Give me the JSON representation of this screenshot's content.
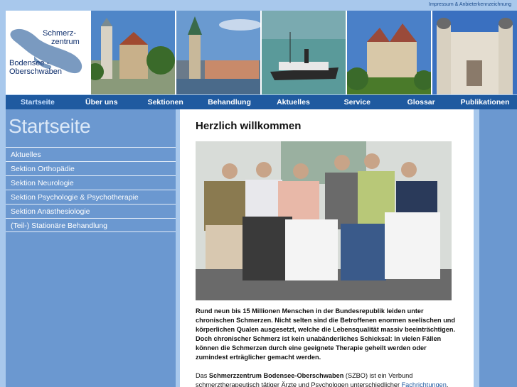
{
  "top": {
    "impressum": "Impressum & Anbieterkennzeichnung"
  },
  "logo": {
    "line1": "Schmerz-",
    "line2": "zentrum",
    "line3": "Bodensee -",
    "line4": "Oberschwaben"
  },
  "nav": {
    "items": [
      "Startseite",
      "Über uns",
      "Sektionen",
      "Behandlung",
      "Aktuelles",
      "Service",
      "Glossar",
      "Publikationen"
    ],
    "active_index": 0
  },
  "sidebar": {
    "title": "Startseite",
    "items": [
      "Aktuelles",
      "Sektion Orthopädie",
      "Sektion Neurologie",
      "Sektion Psychologie & Psychotherapie",
      "Sektion Anästhesiologie",
      "(Teil-) Stationäre Behandlung"
    ]
  },
  "main": {
    "heading": "Herzlich willkommen",
    "intro": "Rund neun bis 15 Millionen Menschen in der Bundesrepublik leiden unter chronischen Schmerzen. Nicht selten sind die Betroffenen enormen seelischen und körperlichen Qualen ausgesetzt, welche die Lebensqualität massiv beeinträchtigen. Doch chronischer Schmerz ist kein unabänderliches Schicksal: In vielen Fällen können die Schmerzen durch eine geeignete Therapie geheilt werden oder zumindest erträglicher gemacht werden.",
    "para2_start": "Das ",
    "para2_bold": "Schmerzzentrum Bodensee-Oberschwaben",
    "para2_mid": " (SZBO) ist ein Verbund schmerztherapeutisch tätiger Ärzte und Psychologen unterschiedlicher ",
    "para2_link": "Fachrichtungen",
    "para2_end": "."
  },
  "colors": {
    "page_bg": "#a8c8ec",
    "nav_bg": "#1f5aa0",
    "sidebar_bg": "#6b98d0",
    "accent_text": "#0d2d6b"
  }
}
